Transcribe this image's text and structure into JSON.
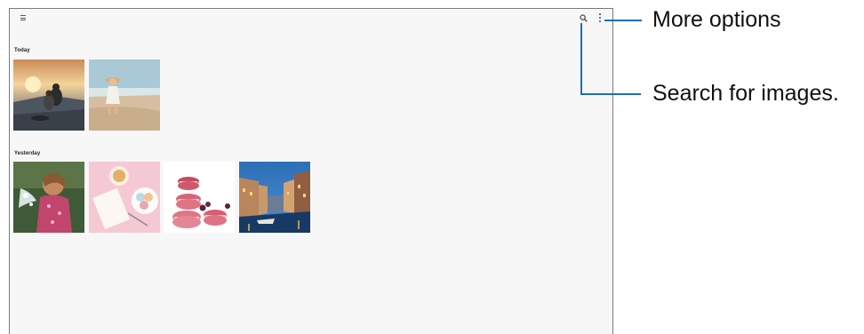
{
  "sections": [
    {
      "label": "Today"
    },
    {
      "label": "Yesterday"
    }
  ],
  "toolbar": {
    "menu_icon": "hamburger-icon",
    "search_icon": "magnifier-icon",
    "more_icon": "vertical-dots-icon"
  },
  "callouts": {
    "more_options": "More options",
    "search": "Search for images."
  },
  "colors": {
    "callout_line": "#1e6fb5",
    "screen_background": "#f7f7f7"
  }
}
